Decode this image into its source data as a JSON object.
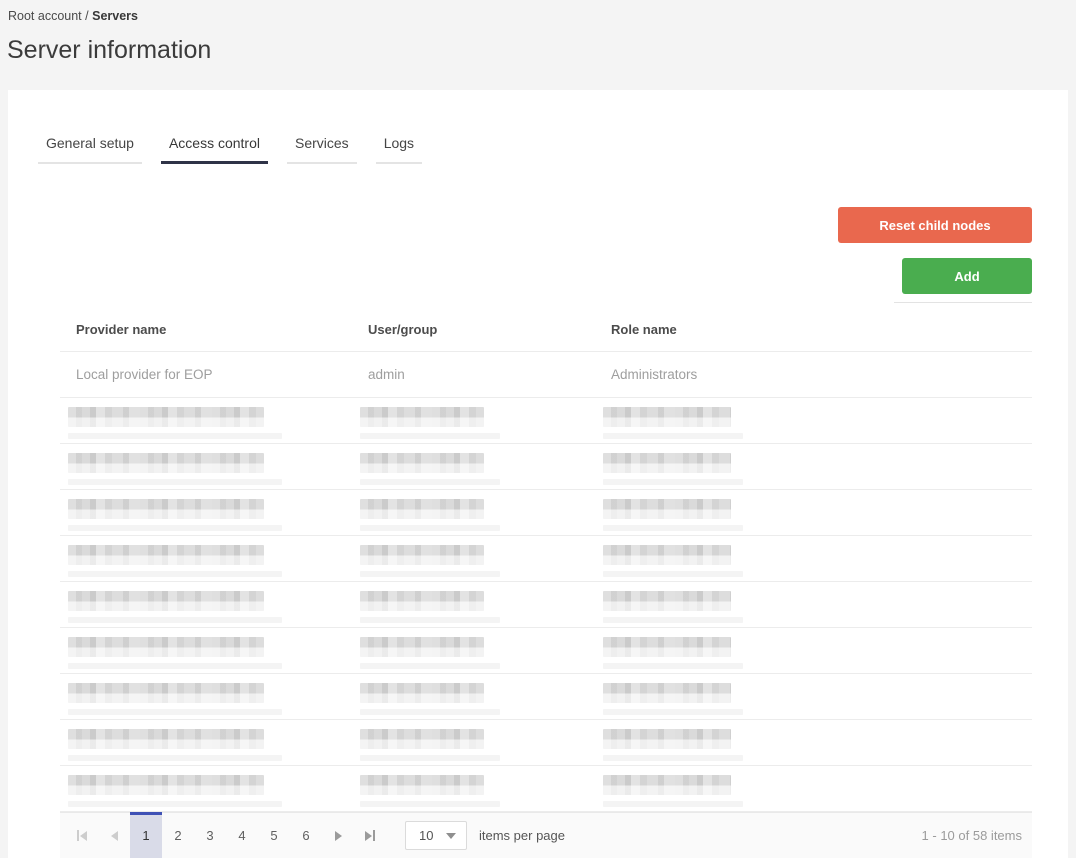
{
  "breadcrumb": {
    "root": "Root account",
    "separator": "/",
    "current": "Servers"
  },
  "page": {
    "title": "Server information"
  },
  "tabs": [
    {
      "label": "General setup",
      "active": false
    },
    {
      "label": "Access control",
      "active": true
    },
    {
      "label": "Services",
      "active": false
    },
    {
      "label": "Logs",
      "active": false
    }
  ],
  "actions": {
    "reset_button": "Reset child nodes",
    "add_button": "Add"
  },
  "colors": {
    "reset_button_bg": "#e9684e",
    "add_button_bg": "#4aad4f",
    "pager_accent": "#3f51b5",
    "pager_selected_bg": "#d9dbe8",
    "active_tab_underline": "#2f3347",
    "page_background": "#f4f4f4"
  },
  "table": {
    "columns": [
      "Provider name",
      "User/group",
      "Role name"
    ],
    "rows": [
      {
        "provider": "Local provider for EOP",
        "user": "admin",
        "role": "Administrators",
        "redacted": false
      },
      {
        "provider": "",
        "user": "",
        "role": "",
        "redacted": true
      },
      {
        "provider": "",
        "user": "",
        "role": "",
        "redacted": true
      },
      {
        "provider": "",
        "user": "",
        "role": "",
        "redacted": true
      },
      {
        "provider": "",
        "user": "",
        "role": "",
        "redacted": true
      },
      {
        "provider": "",
        "user": "",
        "role": "",
        "redacted": true
      },
      {
        "provider": "",
        "user": "",
        "role": "",
        "redacted": true
      },
      {
        "provider": "",
        "user": "",
        "role": "",
        "redacted": true
      },
      {
        "provider": "",
        "user": "",
        "role": "",
        "redacted": true
      },
      {
        "provider": "",
        "user": "",
        "role": "",
        "redacted": true
      }
    ]
  },
  "pagination": {
    "pages": [
      "1",
      "2",
      "3",
      "4",
      "5",
      "6"
    ],
    "current_page": "1",
    "page_size": "10",
    "items_per_page_label": "items per page",
    "range_label": "1 - 10 of 58 items"
  }
}
